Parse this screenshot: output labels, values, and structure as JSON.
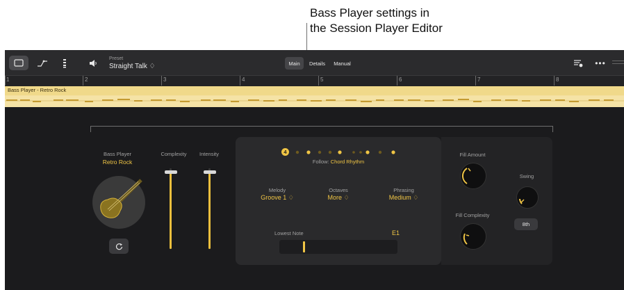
{
  "callout": {
    "line1": "Bass Player settings in",
    "line2": "the Session Player Editor"
  },
  "toolbar": {
    "preset_label": "Preset",
    "preset_value": "Straight Talk ♢",
    "tabs": [
      "Main",
      "Details",
      "Manual"
    ],
    "selected_tab": "Main"
  },
  "ruler": {
    "bars": [
      "1",
      "2",
      "3",
      "4",
      "5",
      "6",
      "7",
      "8"
    ]
  },
  "region": {
    "name": "Bass Player - Retro Rock"
  },
  "player": {
    "label": "Bass Player",
    "style": "Retro Rock"
  },
  "sliders": {
    "complexity_label": "Complexity",
    "intensity_label": "Intensity",
    "complexity_level": 0.95,
    "intensity_level": 0.95
  },
  "rhythm": {
    "count_badge": "4",
    "follow_label": "Follow:",
    "follow_value": "Chord Rhythm"
  },
  "params": {
    "melody_label": "Melody",
    "melody_value": "Groove 1 ♢",
    "octaves_label": "Octaves",
    "octaves_value": "More ♢",
    "phrasing_label": "Phrasing",
    "phrasing_value": "Medium ♢"
  },
  "lowest_note": {
    "label": "Lowest Note",
    "value": "E1"
  },
  "fill": {
    "amount_label": "Fill Amount",
    "complexity_label": "Fill Complexity",
    "swing_label": "Swing",
    "swing_button": "8th"
  },
  "colors": {
    "accent": "#f0c545",
    "background": "#1b1b1d",
    "region": "#f4e0a0"
  }
}
